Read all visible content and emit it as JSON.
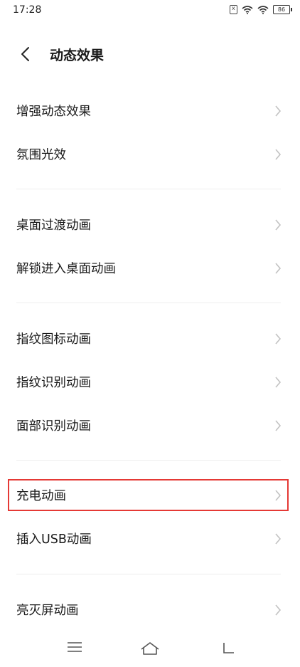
{
  "status_bar": {
    "time": "17:28",
    "battery": "86"
  },
  "header": {
    "title": "动态效果"
  },
  "groups": [
    {
      "items": [
        "增强动态效果",
        "氛围光效"
      ]
    },
    {
      "items": [
        "桌面过渡动画",
        "解锁进入桌面动画"
      ]
    },
    {
      "items": [
        "指纹图标动画",
        "指纹识别动画",
        "面部识别动画"
      ]
    },
    {
      "items": [
        "充电动画",
        "插入USB动画"
      ]
    },
    {
      "items": [
        "亮灭屏动画"
      ]
    }
  ],
  "colors": {
    "highlight": "#e53935",
    "chevron": "#c2c2c2"
  }
}
